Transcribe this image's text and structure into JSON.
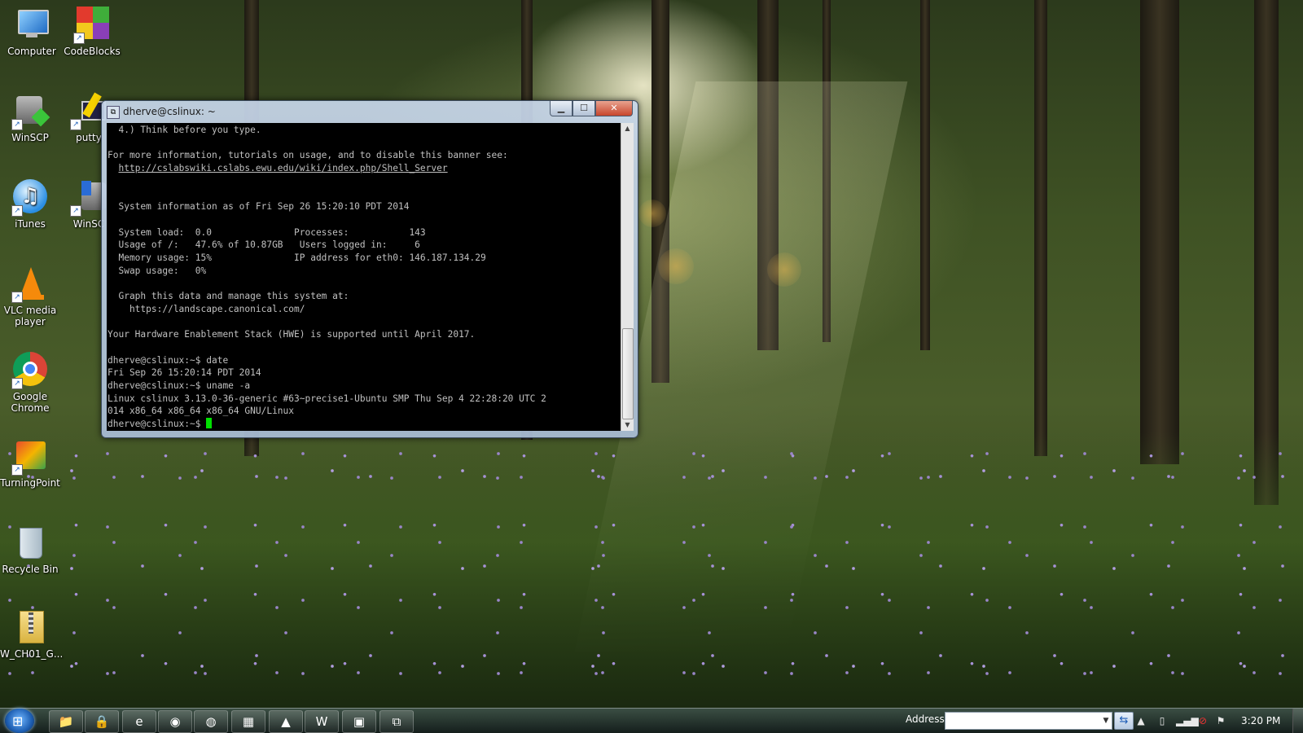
{
  "desktop": {
    "icons": [
      {
        "label": "Computer",
        "icon": "computer-icon"
      },
      {
        "label": "CodeBlocks",
        "icon": "codeblocks-icon"
      },
      {
        "label": "WinSCP",
        "icon": "winscp-icon"
      },
      {
        "label": "putty",
        "icon": "putty-icon"
      },
      {
        "label": "iTunes",
        "icon": "itunes-icon"
      },
      {
        "label": "WinSC",
        "icon": "winscp-icon"
      },
      {
        "label": "VLC media player",
        "icon": "vlc-icon"
      },
      {
        "label": "Google Chrome",
        "icon": "chrome-icon"
      },
      {
        "label": "TurningPoint",
        "icon": "turningpoint-icon"
      },
      {
        "label": "Recycle Bin",
        "icon": "recycle-bin-icon"
      },
      {
        "label": "W_CH01_G...",
        "icon": "zip-folder-icon"
      }
    ]
  },
  "terminal": {
    "title": "dherve@cslinux: ~",
    "lines": [
      "  4.) Think before you type.",
      "",
      "For more information, tutorials on usage, and to disable this banner see:",
      "  http://cslabswiki.cslabs.ewu.edu/wiki/index.php/Shell_Server",
      "",
      "",
      "  System information as of Fri Sep 26 15:20:10 PDT 2014",
      "",
      "  System load:  0.0               Processes:           143",
      "  Usage of /:   47.6% of 10.87GB   Users logged in:     6",
      "  Memory usage: 15%               IP address for eth0: 146.187.134.29",
      "  Swap usage:   0%",
      "",
      "  Graph this data and manage this system at:",
      "    https://landscape.canonical.com/",
      "",
      "Your Hardware Enablement Stack (HWE) is supported until April 2017.",
      "",
      "dherve@cslinux:~$ date",
      "Fri Sep 26 15:20:14 PDT 2014",
      "dherve@cslinux:~$ uname -a",
      "Linux cslinux 3.13.0-36-generic #63~precise1-Ubuntu SMP Thu Sep 4 22:28:20 UTC 2",
      "014 x86_64 x86_64 x86_64 GNU/Linux"
    ],
    "prompt": "dherve@cslinux:~$ ",
    "link_line_index": 3,
    "text_color": "#c0c0c0",
    "cursor_color": "#00e000"
  },
  "taskbar": {
    "start_icon": "windows-start-icon",
    "buttons": [
      {
        "icon": "explorer-icon",
        "glyph": "📁"
      },
      {
        "icon": "lock-icon",
        "glyph": "🔒"
      },
      {
        "icon": "internet-explorer-icon",
        "glyph": "e"
      },
      {
        "icon": "chrome-icon",
        "glyph": "◉"
      },
      {
        "icon": "firefox-icon",
        "glyph": "◍"
      },
      {
        "icon": "codeblocks-icon",
        "glyph": "▦"
      },
      {
        "icon": "acrobat-icon",
        "glyph": "▲"
      },
      {
        "icon": "word-icon",
        "glyph": "W"
      },
      {
        "icon": "network-app-icon",
        "glyph": "▣"
      },
      {
        "icon": "putty-icon",
        "glyph": "⧉"
      }
    ],
    "address_label": "Address",
    "address_value": "",
    "clock": "3:20 PM"
  }
}
